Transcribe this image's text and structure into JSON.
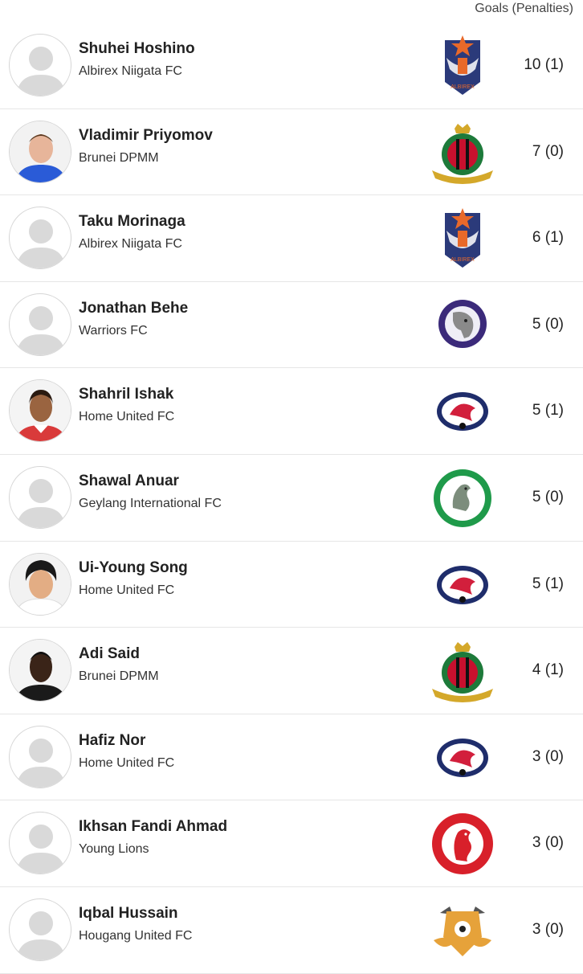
{
  "header": {
    "column_label": "Goals (Penalties)"
  },
  "players": [
    {
      "name": "Shuhei Hoshino",
      "team": "Albirex Niigata FC",
      "goals": "10 (1)",
      "avatar": "placeholder-avatar-icon",
      "crest": "albirex-niigata-crest-icon"
    },
    {
      "name": "Vladimir Priyomov",
      "team": "Brunei DPMM",
      "goals": "7 (0)",
      "avatar": "player-photo",
      "crest": "brunei-dpmm-crest-icon"
    },
    {
      "name": "Taku Morinaga",
      "team": "Albirex Niigata FC",
      "goals": "6 (1)",
      "avatar": "placeholder-avatar-icon",
      "crest": "albirex-niigata-crest-icon"
    },
    {
      "name": "Jonathan Behe",
      "team": "Warriors FC",
      "goals": "5 (0)",
      "avatar": "placeholder-avatar-icon",
      "crest": "warriors-fc-crest-icon"
    },
    {
      "name": "Shahril Ishak",
      "team": "Home United FC",
      "goals": "5 (1)",
      "avatar": "player-photo",
      "crest": "home-united-crest-icon"
    },
    {
      "name": "Shawal Anuar",
      "team": "Geylang International FC",
      "goals": "5 (0)",
      "avatar": "placeholder-avatar-icon",
      "crest": "geylang-international-crest-icon"
    },
    {
      "name": "Ui-Young Song",
      "team": "Home United FC",
      "goals": "5 (1)",
      "avatar": "player-photo",
      "crest": "home-united-crest-icon"
    },
    {
      "name": "Adi Said",
      "team": "Brunei DPMM",
      "goals": "4 (1)",
      "avatar": "player-photo",
      "crest": "brunei-dpmm-crest-icon"
    },
    {
      "name": "Hafiz Nor",
      "team": "Home United FC",
      "goals": "3 (0)",
      "avatar": "placeholder-avatar-icon",
      "crest": "home-united-crest-icon"
    },
    {
      "name": "Ikhsan Fandi Ahmad",
      "team": "Young Lions",
      "goals": "3 (0)",
      "avatar": "placeholder-avatar-icon",
      "crest": "young-lions-crest-icon"
    },
    {
      "name": "Iqbal Hussain",
      "team": "Hougang United FC",
      "goals": "3 (0)",
      "avatar": "placeholder-avatar-icon",
      "crest": "hougang-united-crest-icon"
    }
  ],
  "colors": {
    "albirex_navy": "#2b3a7a",
    "albirex_orange": "#e8692a",
    "dpmm_red": "#c8102e",
    "dpmm_green": "#1d7a3a",
    "dpmm_gold": "#d4a82a",
    "warriors_purple": "#3b2a7a",
    "home_united_red": "#d21f3c",
    "home_united_navy": "#1f2d6b",
    "geylang_green": "#1f9a4a",
    "young_lions_red": "#d8202a",
    "hougang_orange": "#e6a23a"
  }
}
